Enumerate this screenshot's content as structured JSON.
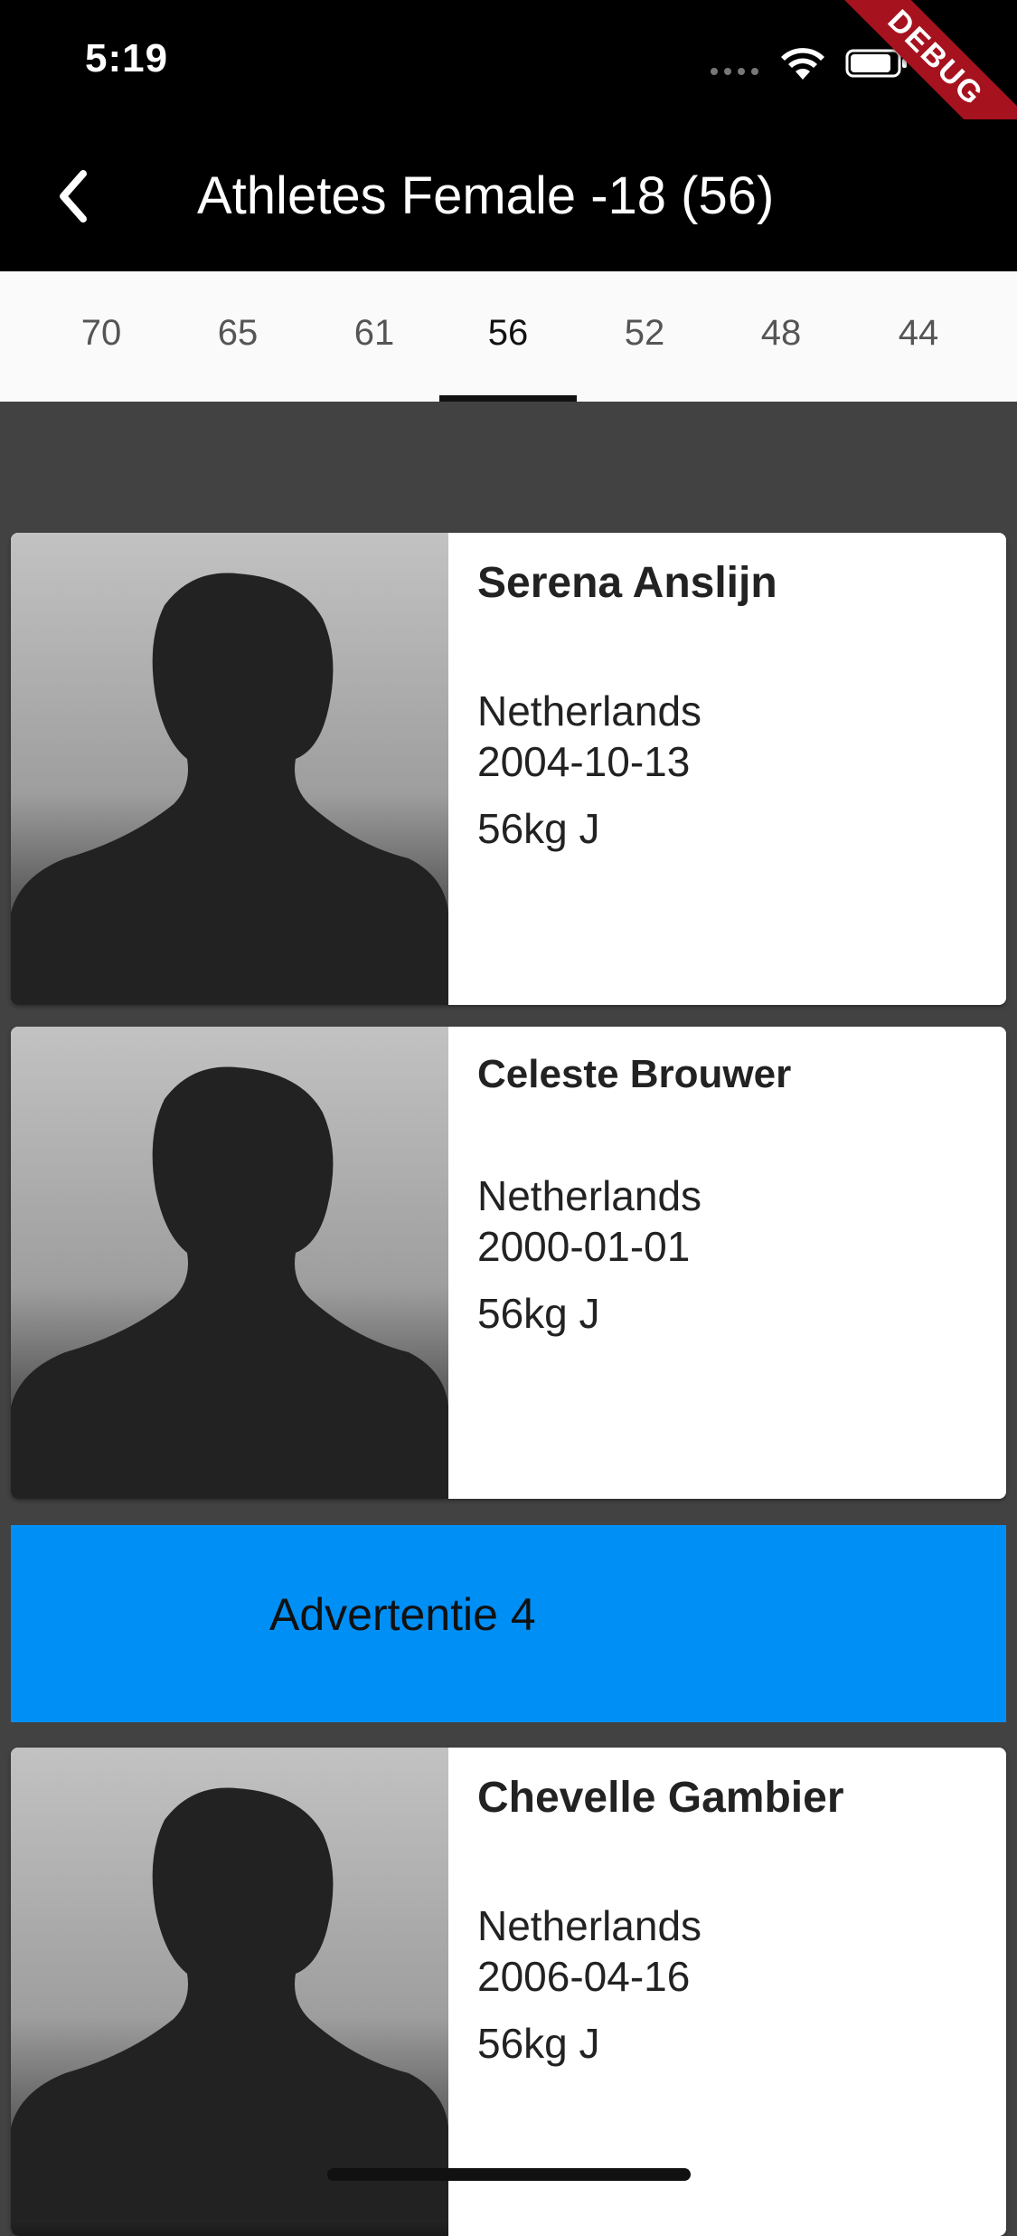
{
  "status_bar": {
    "time": "5:19",
    "icons": [
      "signal-dots-icon",
      "wifi-icon",
      "battery-icon"
    ]
  },
  "debug_banner": {
    "label": "DEBUG"
  },
  "app_bar": {
    "back_icon": "chevron-left-icon",
    "title": "Athletes Female -18 (56)"
  },
  "tabs": [
    {
      "label": "70",
      "active": false
    },
    {
      "label": "65",
      "active": false
    },
    {
      "label": "61",
      "active": false
    },
    {
      "label": "56",
      "active": true
    },
    {
      "label": "52",
      "active": false
    },
    {
      "label": "48",
      "active": false
    },
    {
      "label": "44",
      "active": false
    }
  ],
  "athletes": [
    {
      "name": "Serena Anslijn",
      "country": "Netherlands",
      "dob": "2004-10-13",
      "weight": "56kg  J"
    },
    {
      "name": "Celeste Brouwer",
      "country": "Netherlands",
      "dob": "2000-01-01",
      "weight": "56kg  J"
    },
    {
      "name": "Chevelle Gambier",
      "country": "Netherlands",
      "dob": "2006-04-16",
      "weight": "56kg  J"
    }
  ],
  "ad": {
    "label": "Advertentie 4"
  },
  "colors": {
    "app_bar": "#000000",
    "tab_bar": "#fafafa",
    "background": "#424242",
    "ad_banner": "#008ff5",
    "debug_ribbon": "#a6121e"
  }
}
